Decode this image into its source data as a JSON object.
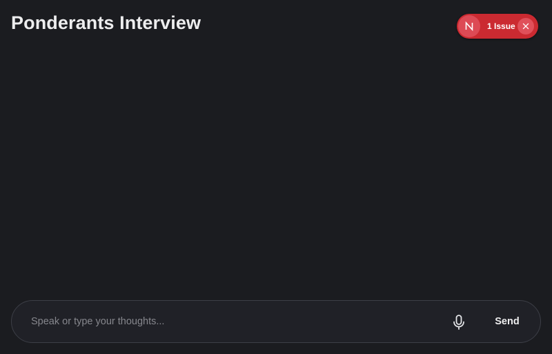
{
  "header": {
    "title": "Ponderants Interview"
  },
  "issue_indicator": {
    "badge_letter": "N",
    "label": "1 Issue",
    "color": "#cb2a31",
    "close_icon": "close-icon"
  },
  "composer": {
    "placeholder": "Speak or type your thoughts...",
    "value": "",
    "mic_icon": "microphone-icon",
    "send_label": "Send"
  },
  "theme": {
    "background": "#1b1c20",
    "accent_error": "#cb2a31"
  }
}
